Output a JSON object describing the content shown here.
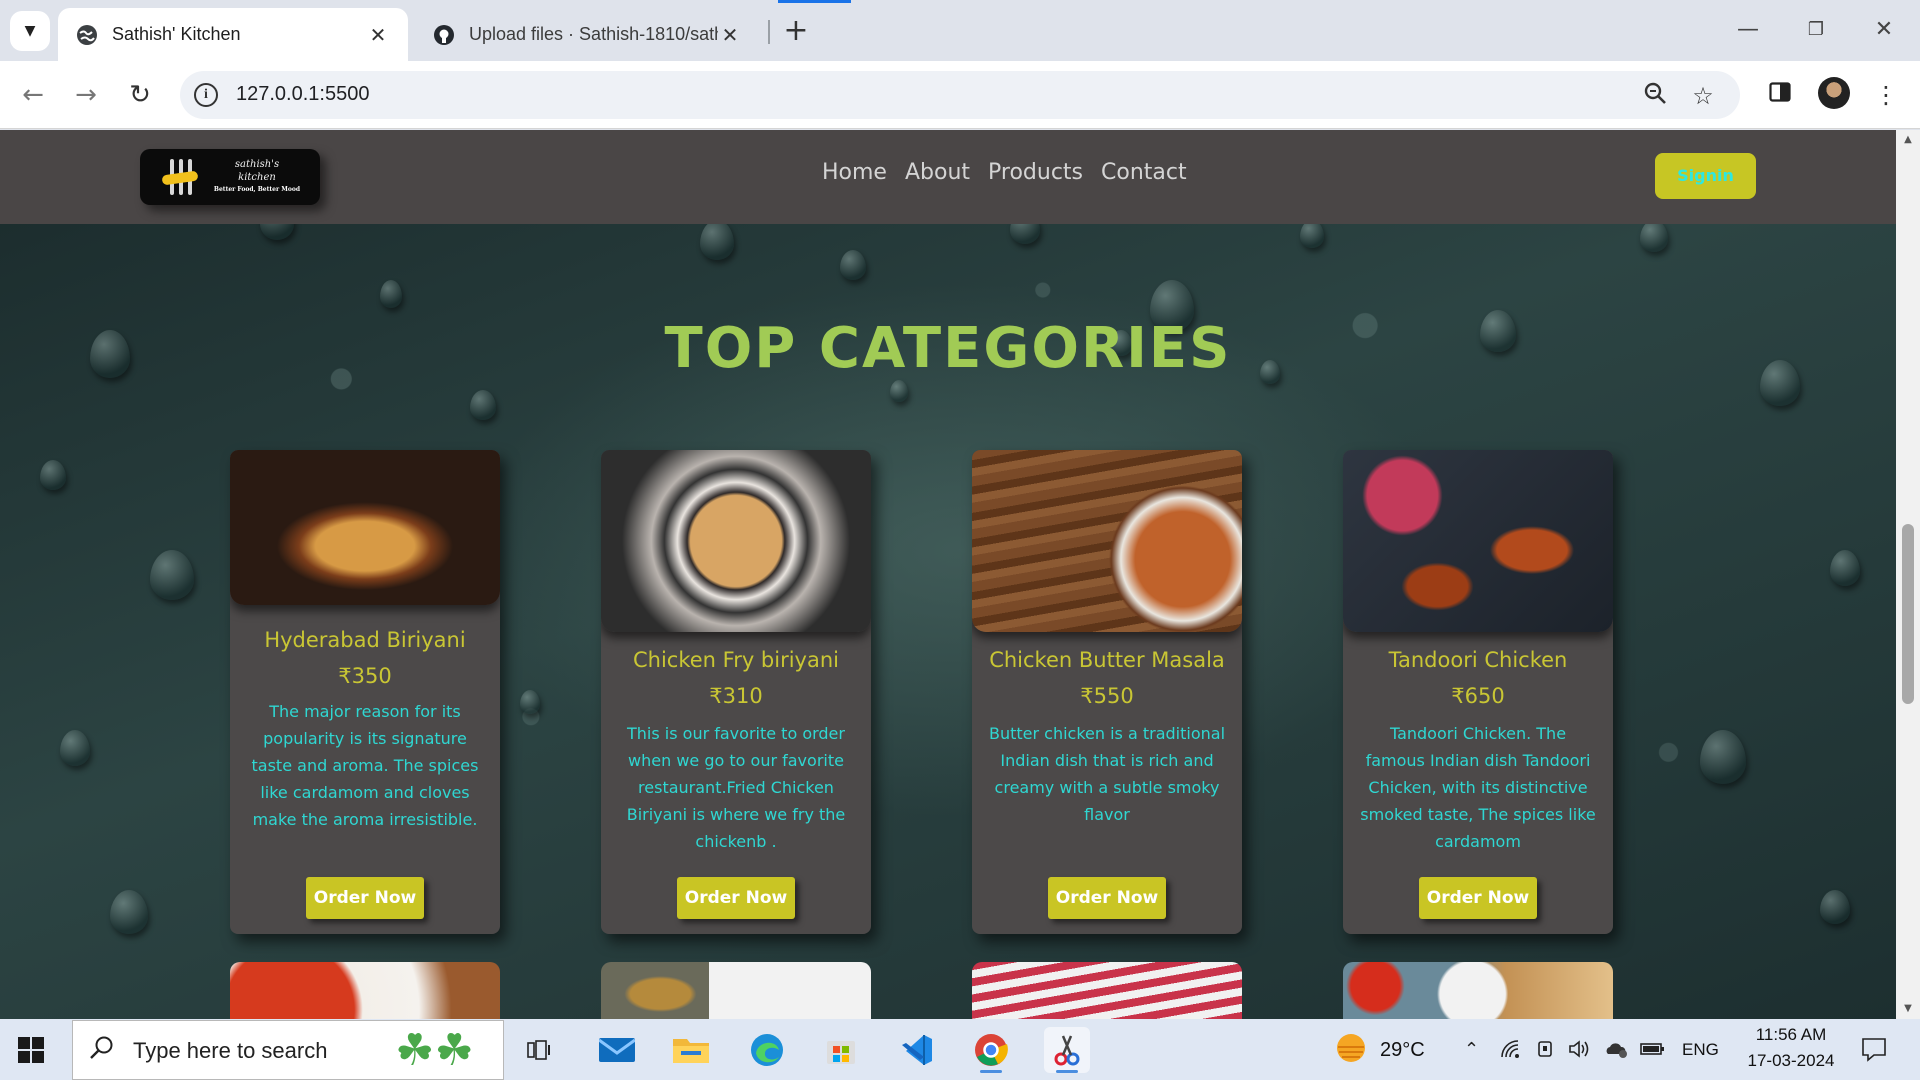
{
  "browser": {
    "tabs": [
      {
        "title": "Sathish' Kitchen",
        "active": true,
        "favicon": "globe-icon"
      },
      {
        "title": "Upload files · Sathish-1810/sathish",
        "active": false,
        "favicon": "github-icon"
      }
    ],
    "url": "127.0.0.1:5500"
  },
  "site": {
    "logo": {
      "brand_line1": "sathish's",
      "brand_line2": "kitchen",
      "tagline": "Better Food, Better Mood"
    },
    "menu": [
      "Home",
      "About",
      "Products",
      "Contact"
    ],
    "signin_label": "Signin",
    "section_title": "TOP CATEGORIES",
    "order_label": "Order Now",
    "cards": [
      {
        "name": "Hyderabad Biriyani",
        "price": "₹350",
        "desc": "The major reason for its popularity is its signature taste and aroma. The spices like cardamom and cloves make the aroma irresistible."
      },
      {
        "name": "Chicken Fry biriyani",
        "price": "₹310",
        "desc": "This is our favorite to order when we go to our favorite restaurant.Fried Chicken Biriyani is where we fry the chickenb ."
      },
      {
        "name": "Chicken Butter Masala",
        "price": "₹550",
        "desc": "Butter chicken is a traditional Indian dish that is rich and creamy with a subtle smoky flavor"
      },
      {
        "name": "Tandoori Chicken",
        "price": "₹650",
        "desc": "Tandoori Chicken. The famous Indian dish Tandoori Chicken, with its distinctive smoked taste, The spices like cardamom"
      }
    ],
    "colors": {
      "title": "#a1cb55",
      "card_heading": "#c9c634",
      "card_text": "#2fd7d2",
      "button": "#c9c524",
      "nav_bg": "#4a4646"
    }
  },
  "taskbar": {
    "search_placeholder": "Type here to search",
    "weather": "29°C",
    "language": "ENG",
    "time": "11:56 AM",
    "date": "17-03-2024"
  }
}
